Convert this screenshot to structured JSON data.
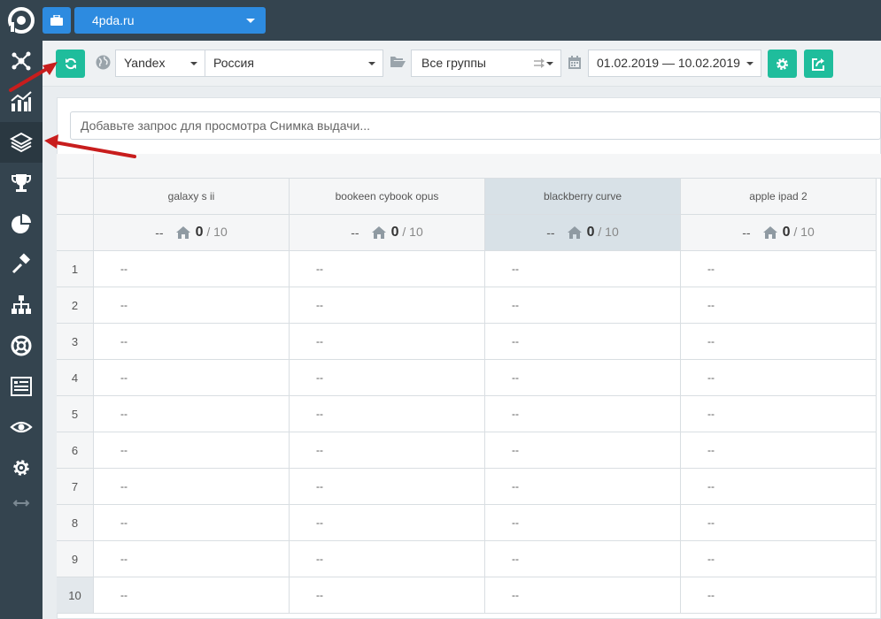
{
  "topbar": {
    "project": "4pda.ru"
  },
  "toolbar": {
    "engine": "Yandex",
    "region": "Россия",
    "groups": "Все группы",
    "date_range": "01.02.2019 — 10.02.2019"
  },
  "query": {
    "placeholder": "Добавьте запрос для просмотра Снимка выдачи..."
  },
  "table": {
    "columns": [
      {
        "name": "galaxy s ii",
        "dash": "--",
        "count": "0",
        "total": "/ 10",
        "selected": false
      },
      {
        "name": "bookeen cybook opus",
        "dash": "--",
        "count": "0",
        "total": "/ 10",
        "selected": false
      },
      {
        "name": "blackberry curve",
        "dash": "--",
        "count": "0",
        "total": "/ 10",
        "selected": true
      },
      {
        "name": "apple ipad 2",
        "dash": "--",
        "count": "0",
        "total": "/ 10",
        "selected": false
      }
    ],
    "rows": [
      "1",
      "2",
      "3",
      "4",
      "5",
      "6",
      "7",
      "8",
      "9",
      "10"
    ],
    "empty_value": "--"
  },
  "sidebar": {
    "items": [
      "network-icon",
      "chart-icon",
      "layers-icon",
      "trophy-icon",
      "pie-chart-icon",
      "gavel-icon",
      "sitemap-icon",
      "lifebuoy-icon",
      "report-icon",
      "eye-icon",
      "gear-icon",
      "expand-icon"
    ]
  },
  "colors": {
    "accent_blue": "#2d8be0",
    "accent_green": "#1fbd9c",
    "sidebar": "#34444f",
    "arrow": "#c81d1d"
  }
}
